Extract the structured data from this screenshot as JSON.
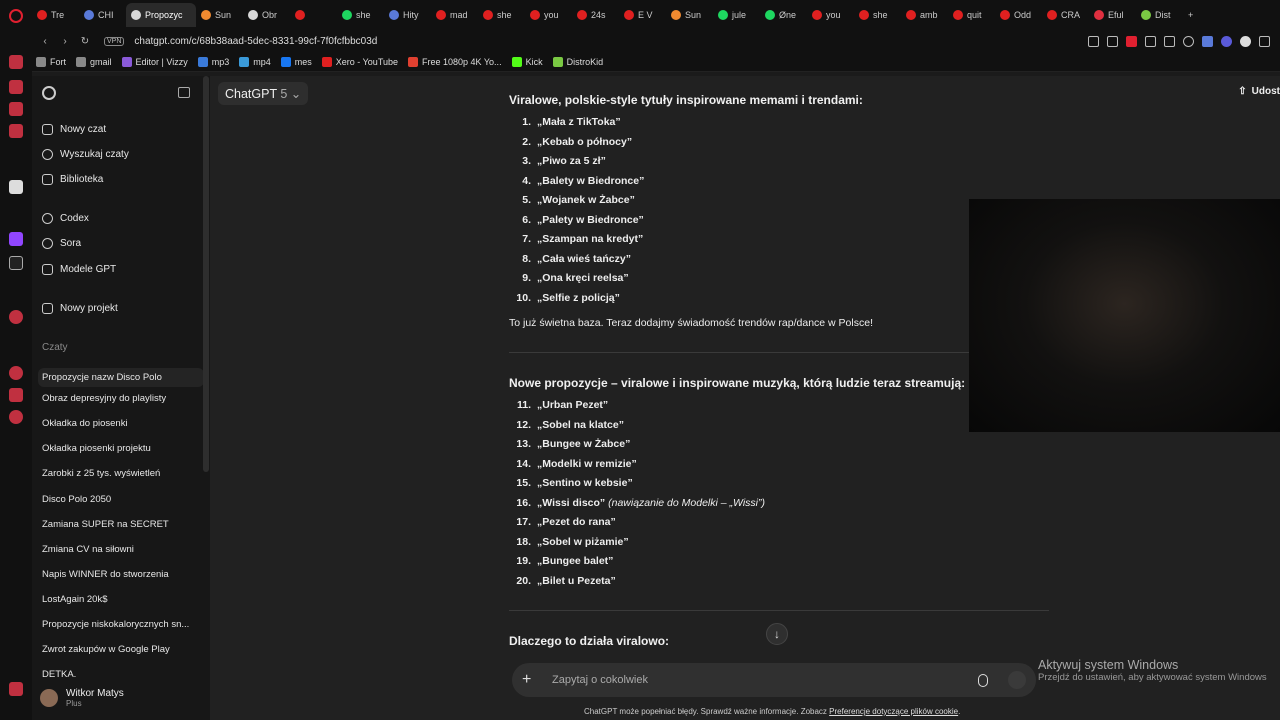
{
  "browser": {
    "tabs": [
      {
        "label": "Tre",
        "color": "#e02020"
      },
      {
        "label": "CHI",
        "color": "#5a7ad9"
      },
      {
        "label": "Propozyc",
        "color": "#d9d9d9",
        "active": true
      },
      {
        "label": "Sun",
        "color": "#f08a30"
      },
      {
        "label": "Obr",
        "color": "#d9d9d9"
      },
      {
        "label": "",
        "color": "#e02020"
      },
      {
        "label": "she",
        "color": "#1ed760"
      },
      {
        "label": "Hity",
        "color": "#5a7ad9"
      },
      {
        "label": "mad",
        "color": "#e02020"
      },
      {
        "label": "she",
        "color": "#e02020"
      },
      {
        "label": "you",
        "color": "#e02020"
      },
      {
        "label": "24s",
        "color": "#e02020"
      },
      {
        "label": "E V",
        "color": "#e02020"
      },
      {
        "label": "Sun",
        "color": "#f08a30"
      },
      {
        "label": "jule",
        "color": "#1ed760"
      },
      {
        "label": "Øne",
        "color": "#1ed760"
      },
      {
        "label": "you",
        "color": "#e02020"
      },
      {
        "label": "she",
        "color": "#e02020"
      },
      {
        "label": "amb",
        "color": "#e02020"
      },
      {
        "label": "quit",
        "color": "#e02020"
      },
      {
        "label": "Odd",
        "color": "#e02020"
      },
      {
        "label": "CRA",
        "color": "#e02020"
      },
      {
        "label": "Eful",
        "color": "#e03040"
      },
      {
        "label": "Dist",
        "color": "#7ac943"
      }
    ],
    "new_tab": "+",
    "url": "chatgpt.com/c/68b38aad-5dec-8331-99cf-7f0fcfbbc03d",
    "vpn_label": "VPN",
    "bookmarks": [
      {
        "label": "Fort",
        "color": "#888"
      },
      {
        "label": "gmail",
        "color": "#888"
      },
      {
        "label": "Editor | Vizzy",
        "color": "#8a5ad9"
      },
      {
        "label": "mp3",
        "color": "#3a7ad9"
      },
      {
        "label": "mp4",
        "color": "#3a9ad9"
      },
      {
        "label": "mes",
        "color": "#1877f2"
      },
      {
        "label": "Xero - YouTube",
        "color": "#e02020"
      },
      {
        "label": "Free 1080p 4K Yo...",
        "color": "#e04030"
      },
      {
        "label": "Kick",
        "color": "#53fc18"
      },
      {
        "label": "DistroKid",
        "color": "#7ac943"
      }
    ]
  },
  "sidebar": {
    "items": [
      {
        "label": "Nowy czat"
      },
      {
        "label": "Wyszukaj czaty"
      },
      {
        "label": "Biblioteka"
      },
      {
        "label": "Codex"
      },
      {
        "label": "Sora"
      },
      {
        "label": "Modele GPT"
      },
      {
        "label": "Nowy projekt"
      }
    ],
    "section_label": "Czaty",
    "chats": [
      "Propozycje nazw Disco Polo",
      "Obraz depresyjny do playlisty",
      "Okładka do piosenki",
      "Okładka piosenki projektu",
      "Zarobki z 25 tys. wyświetleń",
      "Disco Polo 2050",
      "Zamiana SUPER na SECRET",
      "Zmiana CV na siłowni",
      "Napis WINNER do stworzenia",
      "LostAgain 20k$",
      "Propozycje niskokalorycznych sn...",
      "Zwrot zakupów w Google Play",
      "DETKA."
    ],
    "user": {
      "name": "Witkor Matys",
      "plan": "Plus"
    }
  },
  "main": {
    "model_name": "ChatGPT",
    "model_version": "5",
    "share_label": "Udost",
    "heading1": "Viralowe, polskie-style tytuły inspirowane memami i trendami:",
    "list1": [
      {
        "n": "1.",
        "t": "„Mała z TikToka”"
      },
      {
        "n": "2.",
        "t": "„Kebab o północy”"
      },
      {
        "n": "3.",
        "t": "„Piwo za 5 zł”"
      },
      {
        "n": "4.",
        "t": "„Balety w Biedronce”"
      },
      {
        "n": "5.",
        "t": "„Wojanek w Żabce”"
      },
      {
        "n": "6.",
        "t": "„Palety w Biedronce”"
      },
      {
        "n": "7.",
        "t": "„Szampan na kredyt”"
      },
      {
        "n": "8.",
        "t": "„Cała wieś tańczy”"
      },
      {
        "n": "9.",
        "t": "„Ona kręci reelsa”"
      },
      {
        "n": "10.",
        "t": "„Selfie z policją”"
      }
    ],
    "para1": "To już świetna baza. Teraz dodajmy świadomość trendów rap/dance w Polsce!",
    "heading2": "Nowe propozycje – viralowe i inspirowane muzyką, którą ludzie teraz streamują:",
    "list2": [
      {
        "n": "11.",
        "t": "„Urban Pezet”",
        "note": ""
      },
      {
        "n": "12.",
        "t": "„Sobel na klatce”",
        "note": ""
      },
      {
        "n": "13.",
        "t": "„Bungee w Żabce”",
        "note": ""
      },
      {
        "n": "14.",
        "t": "„Modelki w remizie”",
        "note": ""
      },
      {
        "n": "15.",
        "t": "„Sentino w kebsie”",
        "note": ""
      },
      {
        "n": "16.",
        "t": "„Wissi disco”",
        "note": " (nawiązanie do Modelki – „Wissi”)"
      },
      {
        "n": "17.",
        "t": "„Pezet do rana”",
        "note": ""
      },
      {
        "n": "18.",
        "t": "„Sobel w piżamie”",
        "note": ""
      },
      {
        "n": "19.",
        "t": "„Bungee balet”",
        "note": ""
      },
      {
        "n": "20.",
        "t": "„Bilet u Pezeta”",
        "note": ""
      }
    ],
    "heading3": "Dlaczego to działa viralowo:",
    "scroll_down": "↓",
    "composer_placeholder": "Zapytaj o cokolwiek",
    "footer_text": "ChatGPT może popełniać błędy. Sprawdź ważne informacje. Zobacz ",
    "footer_link": "Preferencje dotyczące plików cookie",
    "footer_end": "."
  },
  "windows_activation": {
    "title": "Aktywuj system Windows",
    "subtitle": "Przejdź do ustawień, aby aktywować system Windows"
  }
}
